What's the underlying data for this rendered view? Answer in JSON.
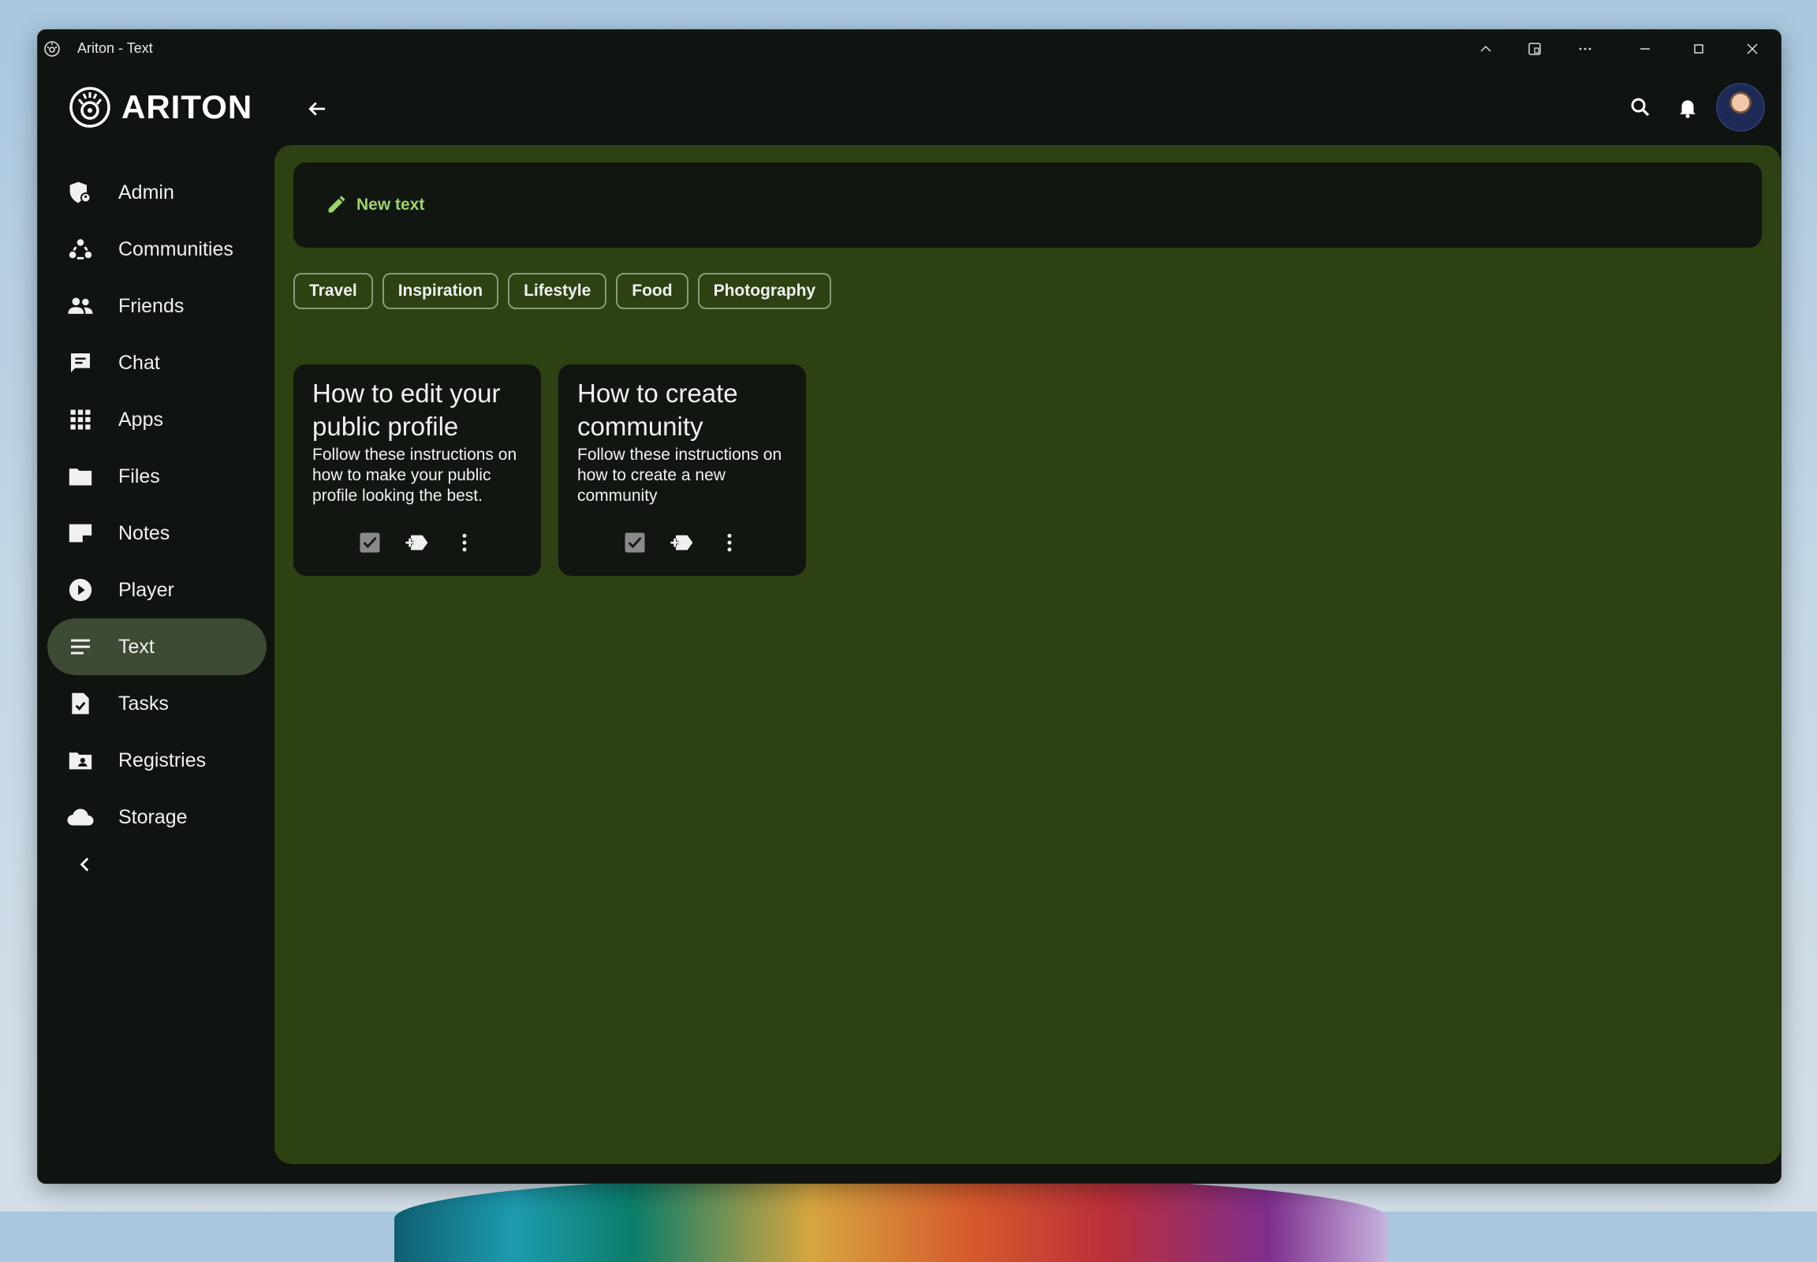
{
  "window": {
    "title": "Ariton - Text"
  },
  "brand": {
    "name": "ARITON"
  },
  "sidebar": {
    "items": [
      {
        "label": "Admin",
        "icon": "admin-icon"
      },
      {
        "label": "Communities",
        "icon": "communities-icon"
      },
      {
        "label": "Friends",
        "icon": "friends-icon"
      },
      {
        "label": "Chat",
        "icon": "chat-icon"
      },
      {
        "label": "Apps",
        "icon": "apps-icon"
      },
      {
        "label": "Files",
        "icon": "folder-icon"
      },
      {
        "label": "Notes",
        "icon": "note-icon"
      },
      {
        "label": "Player",
        "icon": "play-icon"
      },
      {
        "label": "Text",
        "icon": "text-lines-icon",
        "active": true
      },
      {
        "label": "Tasks",
        "icon": "task-icon"
      },
      {
        "label": "Registries",
        "icon": "registry-icon"
      },
      {
        "label": "Storage",
        "icon": "cloud-icon"
      }
    ]
  },
  "main": {
    "new_text_label": "New text",
    "tags": [
      "Travel",
      "Inspiration",
      "Lifestyle",
      "Food",
      "Photography"
    ],
    "cards": [
      {
        "title": "How to edit your public profile",
        "description": "Follow these instructions on how to make your public profile looking the best."
      },
      {
        "title": "How to create community",
        "description": "Follow these instructions on how to create a new community"
      }
    ]
  },
  "colors": {
    "accent": "#9cd36a",
    "content_bg": "#2e4112",
    "window_bg": "#101410",
    "active_nav_bg": "#3d4a34"
  }
}
